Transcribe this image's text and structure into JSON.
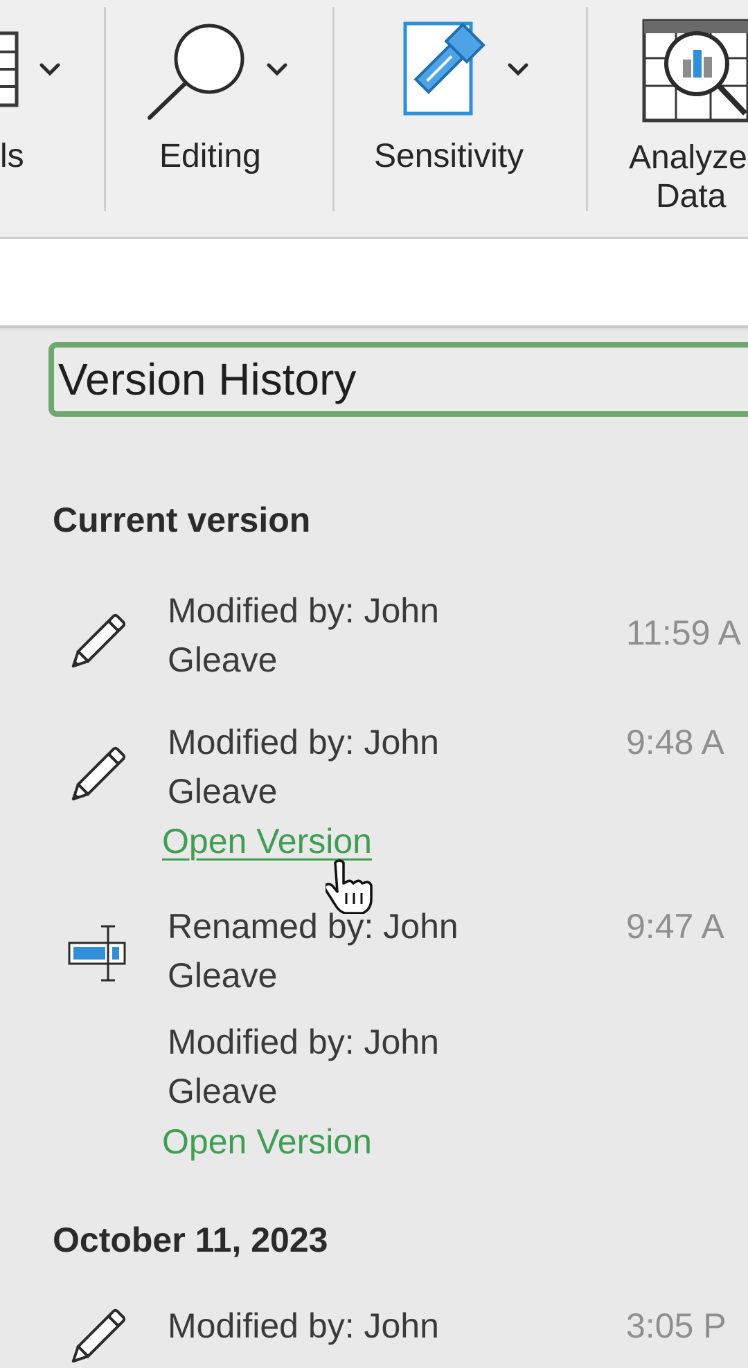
{
  "ribbon": {
    "groups": [
      {
        "label": "ls",
        "icon": "table-icon"
      },
      {
        "label": "Editing",
        "icon": "search-icon"
      },
      {
        "label": "Sensitivity",
        "icon": "sensitivity-label-icon"
      },
      {
        "label_line1": "Analyze",
        "label_line2": "Data",
        "icon": "analyze-data-icon"
      }
    ]
  },
  "pane": {
    "title": "Version History",
    "sections": [
      {
        "heading": "Current version",
        "entries": [
          {
            "line1": "Modified by: John",
            "line2": "Gleave",
            "time": "11:59 A",
            "icon": "pencil-icon",
            "link": ""
          },
          {
            "line1": "Modified by: John",
            "line2": "Gleave",
            "time": "9:48 A",
            "icon": "pencil-icon",
            "link": "Open Version"
          },
          {
            "line1": "Renamed by: John",
            "line2": "Gleave",
            "time": "9:47 A",
            "icon": "rename-icon",
            "link": ""
          },
          {
            "line1": "Modified by: John",
            "line2": "Gleave",
            "time": "",
            "icon": "",
            "link": "Open Version"
          }
        ]
      },
      {
        "heading": "October 11, 2023",
        "entries": [
          {
            "line1": "Modified by: John",
            "time": "3:05 P",
            "icon": "pencil-icon"
          }
        ]
      }
    ]
  },
  "colors": {
    "link": "#3f9e53",
    "focus_border": "#6ea86e",
    "icon_blue": "#2f8fd8"
  },
  "cursor": "hand-pointer-icon"
}
